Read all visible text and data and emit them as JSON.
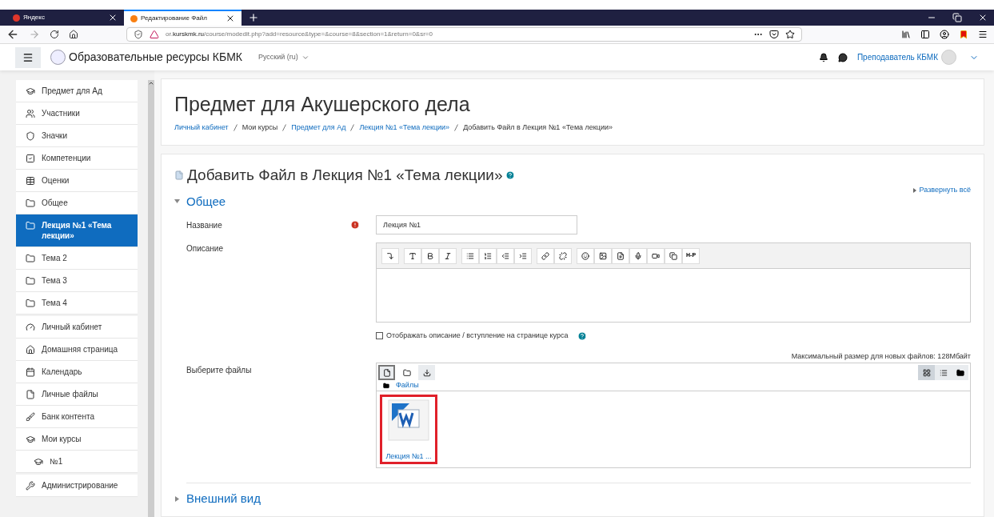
{
  "browser": {
    "tabs": [
      {
        "label": "Яндекс",
        "selected": false
      },
      {
        "label": "Редактирование Файл",
        "selected": true
      }
    ],
    "url_host": "or.",
    "url_domain": "kurskmk.ru",
    "url_path": "/course/modedit.php?add=resource&type=&course=8&section=1&return=0&sr=0"
  },
  "header": {
    "site_name": "Образовательные ресурсы КБМК",
    "language": "Русский (ru)",
    "user": "Преподаватель КБМК"
  },
  "sidebar": {
    "groups": [
      {
        "items": [
          {
            "label": "Предмет для Ад",
            "selected": false
          },
          {
            "label": "Участники",
            "selected": false
          },
          {
            "label": "Значки",
            "selected": false
          },
          {
            "label": "Компетенции",
            "selected": false
          },
          {
            "label": "Оценки",
            "selected": false
          },
          {
            "label": "Общее",
            "selected": false
          },
          {
            "label": "Лекция №1 «Тема лекции»",
            "selected": true
          },
          {
            "label": "Тема 2",
            "selected": false
          },
          {
            "label": "Тема 3",
            "selected": false
          },
          {
            "label": "Тема 4",
            "selected": false
          }
        ]
      },
      {
        "items": [
          {
            "label": "Личный кабинет",
            "selected": false
          },
          {
            "label": "Домашняя страница",
            "selected": false
          },
          {
            "label": "Календарь",
            "selected": false
          },
          {
            "label": "Личные файлы",
            "selected": false
          },
          {
            "label": "Банк контента",
            "selected": false
          },
          {
            "label": "Мои курсы",
            "selected": false,
            "children": [
              {
                "label": "№1",
                "selected": false
              }
            ]
          }
        ]
      },
      {
        "items": [
          {
            "label": "Администрирование",
            "selected": false
          }
        ]
      }
    ]
  },
  "page_header": {
    "title": "Предмет для Акушерского дела",
    "breadcrumb": [
      {
        "label": "Личный кабинет",
        "kind": "link"
      },
      {
        "label": "Мои курсы",
        "kind": "text"
      },
      {
        "label": "Предмет для Ад",
        "kind": "link"
      },
      {
        "label": "Лекция №1 «Тема лекции»",
        "kind": "link"
      },
      {
        "label": "Добавить Файл в Лекция №1 «Тема лекции»",
        "kind": "text"
      }
    ]
  },
  "form": {
    "heading": "Добавить Файл в Лекция №1 «Тема лекции»",
    "expand_all": "Развернуть всё",
    "sections": [
      {
        "title": "Общее",
        "expanded": true
      },
      {
        "title": "Внешний вид",
        "expanded": false
      }
    ],
    "name_label": "Название",
    "name_value": "Лекция №1",
    "required": true,
    "description_label": "Описание",
    "editor_hp": "H-P",
    "show_description": {
      "label": "Отображать описание / вступление на странице курса",
      "checked": false
    },
    "files_label": "Выберите файлы",
    "max_size": "Максимальный размер для новых файлов: 128Мбайт",
    "files_path": "Файлы",
    "files": [
      {
        "name": "Лекция №1 ...",
        "highlighted": true
      }
    ]
  }
}
